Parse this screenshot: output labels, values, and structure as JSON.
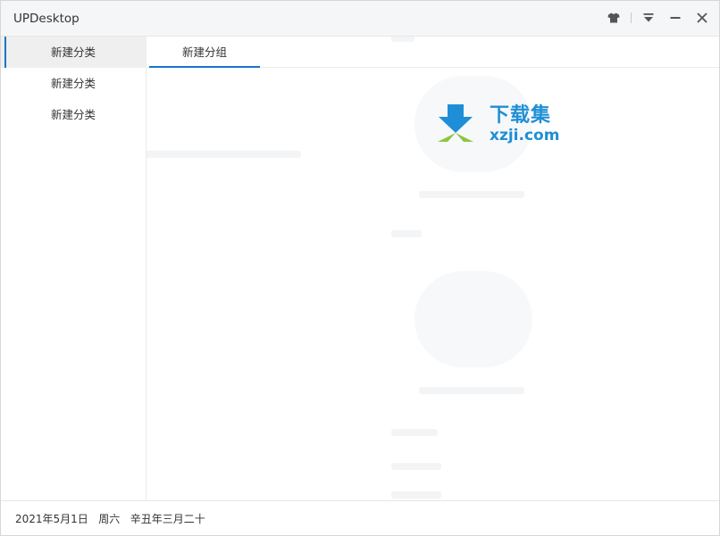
{
  "window": {
    "title": "UPDesktop"
  },
  "titlebar": {
    "icons": [
      "shirt-icon",
      "separator",
      "collapse-icon",
      "minimize-icon",
      "close-icon"
    ]
  },
  "sidebar": {
    "items": [
      {
        "label": "新建分类",
        "active": true
      },
      {
        "label": "新建分类",
        "active": false
      },
      {
        "label": "新建分类",
        "active": false
      }
    ]
  },
  "tabs": [
    {
      "label": "新建分组",
      "active": true
    }
  ],
  "watermark": {
    "cn": "下载集",
    "en": "xzji.com"
  },
  "footer": {
    "date": "2021年5月1日",
    "weekday": "周六",
    "lunar": "辛丑年三月二十"
  },
  "colors": {
    "accent": "#1a73c9",
    "logo_blue": "#1e8fd6",
    "logo_green": "#8cc63f"
  }
}
